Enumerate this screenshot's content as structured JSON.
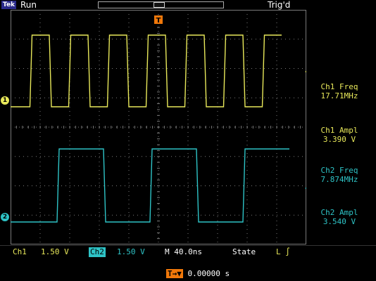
{
  "header": {
    "brand": "Tek",
    "run_state": "Run",
    "trigger_state": "Trig'd",
    "trigger_marker": "T"
  },
  "measurements": [
    {
      "label": "Ch1 Freq",
      "value": "17.71MHz",
      "channel": "ch1"
    },
    {
      "label": "Ch1 Ampl",
      "value": "3.390 V",
      "channel": "ch1"
    },
    {
      "label": "Ch2 Freq",
      "value": "7.874MHz",
      "channel": "ch2"
    },
    {
      "label": "Ch2 Ampl",
      "value": "3.540 V",
      "channel": "ch2"
    }
  ],
  "markers": {
    "ch1": "1",
    "ch2": "2"
  },
  "status": {
    "ch1_label": "Ch1",
    "ch1_scale": "1.50 V",
    "ch2_label": "Ch2",
    "ch2_scale": "1.50 V",
    "timebase": "M 40.0ns",
    "mode": "State",
    "trigger_slope": "L ∫"
  },
  "trigger_position": {
    "icon": "T→▼",
    "value": "0.00000 s"
  },
  "colors": {
    "ch1": "#e8e85a",
    "ch2": "#2ec3c6",
    "trigger": "#f0780a",
    "grid": "#7a7a7a"
  },
  "chart_data": {
    "type": "line",
    "series": [
      {
        "name": "Ch1",
        "values": [
          0,
          1,
          0,
          1,
          0,
          1,
          0,
          1,
          0,
          1,
          0,
          1,
          0,
          1
        ]
      },
      {
        "name": "Ch2",
        "values": [
          0,
          1,
          0,
          1,
          0,
          1
        ]
      }
    ],
    "grid": true
  }
}
